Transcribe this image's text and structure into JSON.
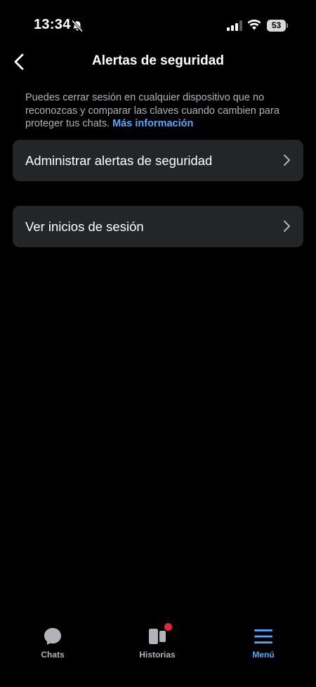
{
  "status_bar": {
    "time": "13:34",
    "battery": "53",
    "icons": [
      "bell-slash-icon",
      "signal-icon",
      "wifi-icon",
      "battery-icon"
    ]
  },
  "header": {
    "back_icon": "chevron-left-icon",
    "title": "Alertas de seguridad"
  },
  "description": {
    "text": "Puedes cerrar sesión en cualquier dispositivo que no reconozcas y comparar las claves cuando cambien para proteger tus chats.",
    "link": "Más información"
  },
  "options": [
    {
      "label": "Administrar alertas de seguridad",
      "icon": "chevron-right-icon"
    },
    {
      "label": "Ver inicios de sesión",
      "icon": "chevron-right-icon"
    }
  ],
  "tab_bar": {
    "tabs": [
      {
        "label": "Chats",
        "icon": "chat-bubble-icon",
        "active": false
      },
      {
        "label": "Historias",
        "icon": "stories-icon",
        "active": false,
        "badge": true
      },
      {
        "label": "Menú",
        "icon": "menu-icon",
        "active": true
      }
    ]
  },
  "colors": {
    "background": "#000000",
    "row_background": "#242526",
    "accent": "#5aa7ff",
    "secondary_text": "#b0b3b8",
    "badge": "#e0283a"
  }
}
